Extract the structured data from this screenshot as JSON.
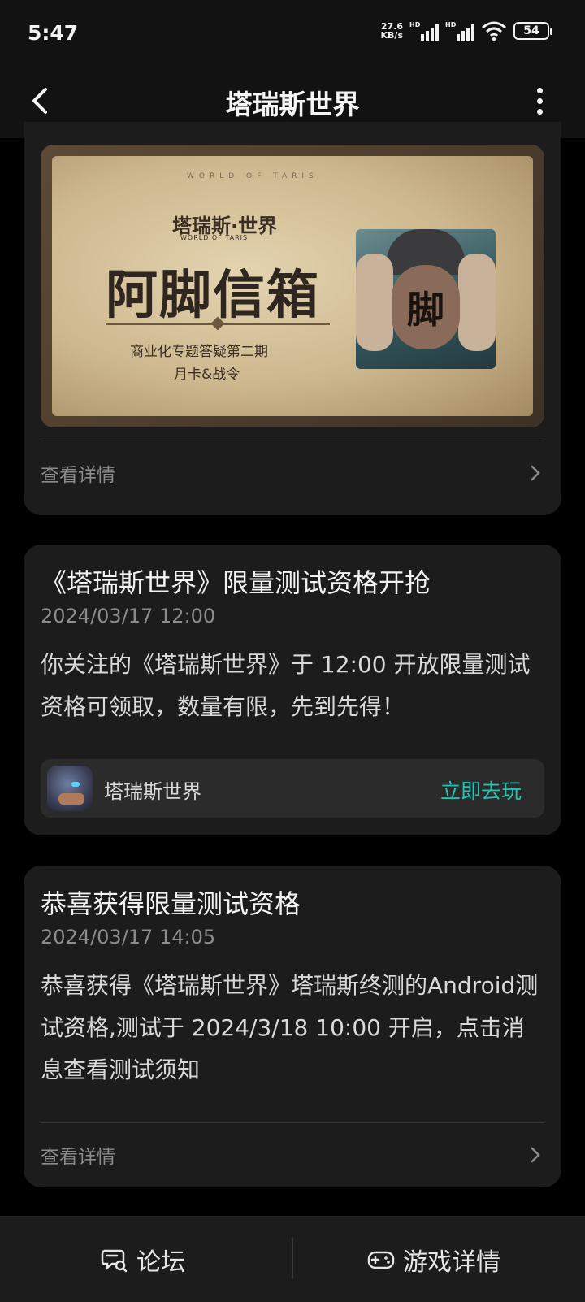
{
  "status_bar": {
    "time": "5:47",
    "net_speed_value": "27.6",
    "net_speed_unit": "KB/s",
    "hd1": "HD",
    "hd2": "HD",
    "battery": "54"
  },
  "header": {
    "title": "塔瑞斯世界"
  },
  "card1": {
    "banner": {
      "small_caption": "WORLD OF TARIS",
      "logo_text": "塔瑞斯·世界",
      "logo_sub": "WORLD OF TARIS",
      "title": "阿脚信箱",
      "subtitle1": "商业化专题答疑第二期",
      "subtitle2": "月卡&战令",
      "portrait_text": "脚"
    },
    "link_label": "查看详情"
  },
  "card2": {
    "title": "《塔瑞斯世界》限量测试资格开抢",
    "time": "2024/03/17 12:00",
    "body": "你关注的《塔瑞斯世界》于 12:00 开放限量测试资格可领取，数量有限，先到先得！",
    "game_name": "塔瑞斯世界",
    "play_label": "立即去玩"
  },
  "card3": {
    "title": "恭喜获得限量测试资格",
    "time": "2024/03/17 14:05",
    "body": "恭喜获得《塔瑞斯世界》塔瑞斯终测的Android测试资格,测试于 2024/3/18 10:00 开启，点击消息查看测试须知",
    "link_label": "查看详情"
  },
  "bottom_nav": {
    "forum_label": "论坛",
    "game_detail_label": "游戏详情"
  },
  "colors": {
    "accent": "#23c2b0",
    "background": "#000000",
    "card": "#1c1c1c"
  }
}
